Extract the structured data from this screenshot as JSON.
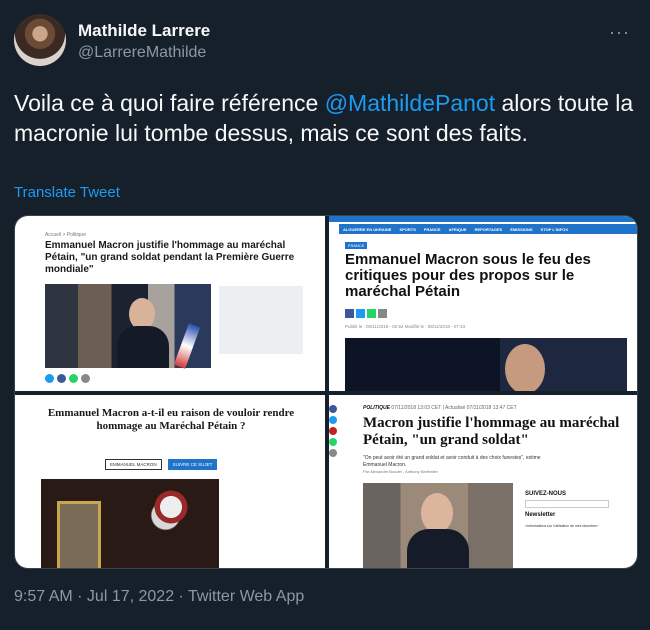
{
  "author": {
    "name": "Mathilde Larrere",
    "handle": "@LarrereMathilde"
  },
  "tweet": {
    "text_before": "Voila ce à quoi faire référence ",
    "mention": "@MathildePanot",
    "text_after": " alors toute la macronie lui tombe dessus, mais ce sont des faits.",
    "translate_label": "Translate Tweet",
    "timestamp": "9:57 AM · Jul 17, 2022 · Twitter Web App"
  },
  "menu": {
    "more_glyph": "···"
  },
  "media": {
    "panel1": {
      "breadcrumb": "Accueil > Politique",
      "headline": "Emmanuel Macron justifie l'hommage au maréchal Pétain, \"un grand soldat pendant la Première Guerre mondiale\""
    },
    "panel2": {
      "nav": [
        "ALGUERRE EN UKRAINE",
        "SPORTS",
        "FRANCE",
        "AFRIQUE",
        "REPORTAGES",
        "ÉMISSIONS",
        "STOP L'INFOX"
      ],
      "tag": "FRANCE",
      "headline": "Emmanuel Macron sous le feu des critiques pour des propos sur le maréchal Pétain",
      "meta": "Publié le : 08/11/2018 - 02:54   Modifié le : 08/11/2018 - 07:43"
    },
    "panel3": {
      "headline": "Emmanuel Macron a-t-il eu raison de vouloir rendre hommage au Maréchal Pétain ?",
      "tag": "EMMANUEL MACRON",
      "follow_button": "SUIVRE CE SUJET"
    },
    "panel4": {
      "rubric": "POLITIQUE",
      "rubric_date": "07/11/2018 13:03 CET | Actualisé 07/11/2018 13:47 CET",
      "headline": "Macron justifie l'hommage au maréchal Pétain, \"un grand soldat\"",
      "lead": "\"On peut avoir été un grand soldat et avoir conduit à des choix funestes\", estime Emmanuel Macron.",
      "byline": "Par Alexandre Boudet , Anthony Berthelier",
      "follow_title": "SUIVEZ-NOUS",
      "newsletter": "Newsletter",
      "info": "«Informations sur l'utilisation de mes données»"
    }
  },
  "colors": {
    "background": "#15202b",
    "text": "#f7f9f9",
    "secondary": "#8b98a5",
    "link": "#1d9bf0"
  }
}
